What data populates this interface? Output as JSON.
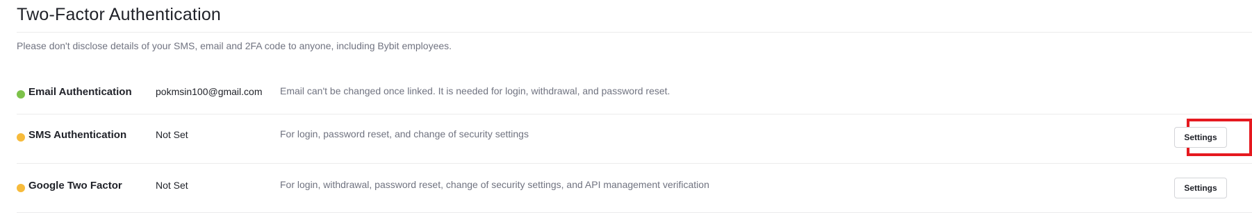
{
  "page": {
    "title": "Two-Factor Authentication",
    "notice": "Please don't disclose details of your SMS, email and 2FA code to anyone, including Bybit employees."
  },
  "methods": [
    {
      "name": "Email Authentication",
      "status": "pokmsin100@gmail.com",
      "description": "Email can't be changed once linked. It is needed for login, withdrawal, and password reset.",
      "indicator_color": "#7dc24a"
    },
    {
      "name": "SMS Authentication",
      "status": "Not Set",
      "description": "For login, password reset, and change of security settings",
      "indicator_color": "#f7bb3b",
      "button_label": "Settings"
    },
    {
      "name": "Google Two Factor",
      "status": "Not Set",
      "description": "For login, withdrawal, password reset, change of security settings, and API management verification",
      "indicator_color": "#f7bb3b",
      "button_label": "Settings"
    }
  ],
  "colors": {
    "highlight": "#e5191f",
    "status_set": "#7dc24a",
    "status_not_set": "#f7bb3b"
  }
}
